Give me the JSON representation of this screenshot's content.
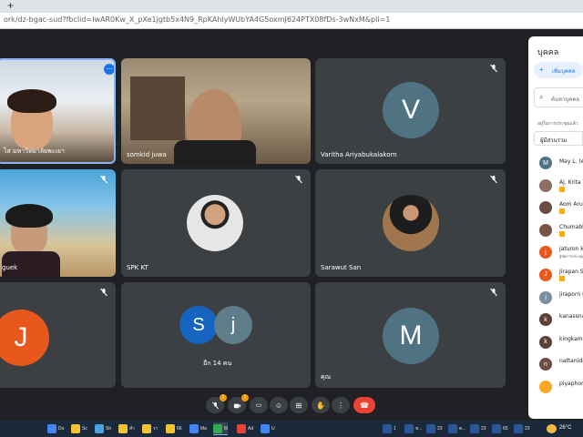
{
  "browser": {
    "new_tab_label": "+",
    "url": "ork/dz-bgac-sud?fbclid=IwAR0Kw_X_pXe1jgtb5x4N9_RpKAhlyWUbYA4G5oxmJ624PTX08fDs-3wNxM&pli=1"
  },
  "tiles": {
    "t1": {
      "name": "ไส มหาวิทยาลัยพะเยา"
    },
    "t2": {
      "name": "somkid juwa"
    },
    "t3": {
      "name": "Varitha Ariyabukalakorn",
      "avatar": "V",
      "avatar_color": "#4f7383"
    },
    "t4": {
      "name": "guek"
    },
    "t5": {
      "name": "SPK KT"
    },
    "t6": {
      "name": "Sarawut San"
    },
    "t7": {
      "avatar": "J",
      "avatar_color": "#e8571c"
    },
    "t8": {
      "others_label": "อีก 14 คน",
      "avatar_s": "S",
      "avatar_j": "j",
      "s_color": "#1565c0",
      "j_color": "#607d8b"
    },
    "t9": {
      "name": "คุณ",
      "avatar": "M",
      "avatar_color": "#4f7383"
    }
  },
  "panel": {
    "title": "บุคคล",
    "add_people": "เพิ่มบุคคล",
    "search_placeholder": "ค้นหาบุคคล",
    "section_label": "อยู่ในการประชุมแล้ว",
    "participants_header": "ผู้มีส่วนร่วม",
    "participants": [
      {
        "name": "May L. (คุณ)",
        "initial": "M",
        "color": "#4f7383",
        "badge": false
      },
      {
        "name": "Aj. Krita T",
        "initial": "",
        "color": "#8d6e63",
        "badge": true
      },
      {
        "name": "Aom Arun",
        "initial": "",
        "color": "#6d4c41",
        "badge": true
      },
      {
        "name": "Chumabl",
        "initial": "",
        "color": "#795548",
        "badge": true
      },
      {
        "name": "jaturon k",
        "initial": "j",
        "color": "#e8571c",
        "badge": false,
        "sub": "ผู้จัดการประชุม"
      },
      {
        "name": "Jirapan S",
        "initial": "J",
        "color": "#e8571c",
        "badge": true
      },
      {
        "name": "jiraporn s",
        "initial": "j",
        "color": "#78909c",
        "badge": false
      },
      {
        "name": "kanassna",
        "initial": "k",
        "color": "#5d4037",
        "badge": false
      },
      {
        "name": "kingkamo",
        "initial": "k",
        "color": "#5d4037",
        "badge": false
      },
      {
        "name": "nattanida",
        "initial": "n",
        "color": "#6d4c41",
        "badge": false
      },
      {
        "name": "piyaphon",
        "initial": "",
        "color": "#f9a825",
        "badge": false
      }
    ]
  },
  "controls": {
    "mic_icon": "microphone-off-icon",
    "cam_icon": "camera-off-icon",
    "warn_mark": "!"
  },
  "taskbar": {
    "items": [
      "Do",
      "Sc",
      "Sh",
      "สำ",
      "รา",
      "66",
      "Ma",
      "M",
      "Ad",
      "U"
    ],
    "word_items": [
      "1",
      "ห...",
      "23",
      "ต...",
      "23",
      "65",
      "23"
    ],
    "temperature": "26°C"
  }
}
